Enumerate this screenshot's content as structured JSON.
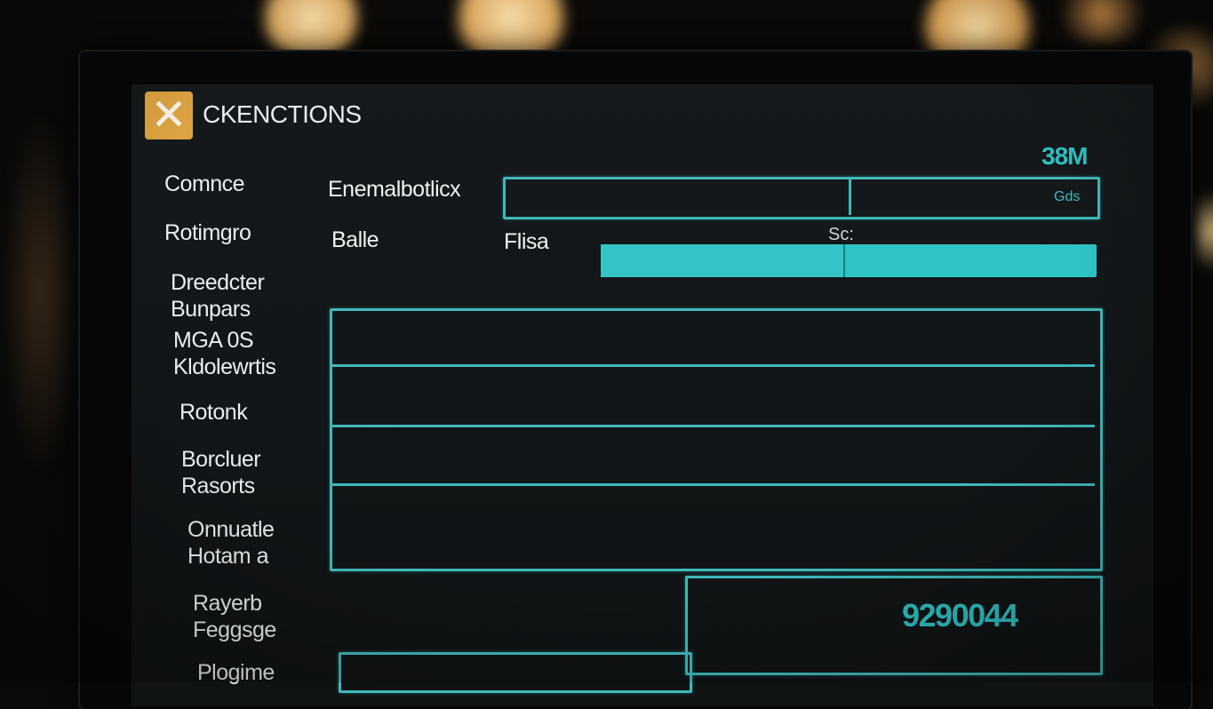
{
  "app": {
    "title": "CKENCTIONS",
    "corner_value": "38M"
  },
  "sidebar": {
    "items": [
      {
        "lines": [
          "Comnce"
        ]
      },
      {
        "lines": [
          "Rotimgro"
        ]
      },
      {
        "lines": [
          "Dreedcter",
          "Bunpars"
        ]
      },
      {
        "lines": [
          "MGA 0S",
          "Kldolewrtis"
        ]
      },
      {
        "lines": [
          "Rotonk"
        ]
      },
      {
        "lines": [
          "Borcluer",
          "Rasorts"
        ]
      },
      {
        "lines": [
          "Onnuatle",
          "Hotam a"
        ]
      },
      {
        "lines": [
          "Rayerb",
          "Feggsge"
        ]
      },
      {
        "lines": [
          "Plogime"
        ]
      }
    ]
  },
  "form": {
    "field_label": "Enemalbotlicx",
    "field_suffix": "Gds",
    "row_label": "Balle",
    "bar_label": "Flisa",
    "bar_caption": "Sc:",
    "bar_progress": 0.49
  },
  "footer": {
    "value": "9290044"
  },
  "colors": {
    "accent": "#3fb9bb",
    "brand": "#dca342",
    "background": "#111517"
  },
  "icons": {
    "logo": "close-icon"
  }
}
